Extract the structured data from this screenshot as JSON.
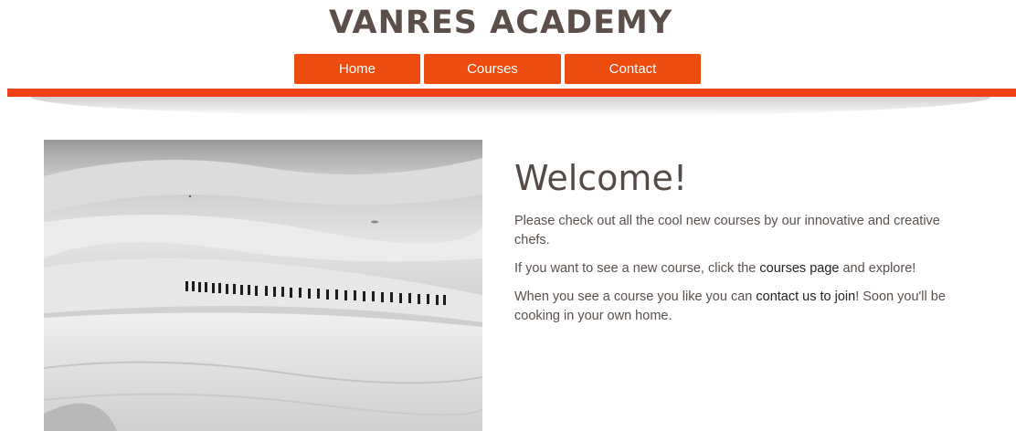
{
  "header": {
    "title": "VANRES ACADEMY"
  },
  "nav": {
    "home": "Home",
    "courses": "Courses",
    "contact": "Contact"
  },
  "colors": {
    "accent": "#ee4b0f",
    "bar": "#ee4117",
    "heading": "#554b46"
  },
  "hero": {
    "image_icon": "hikers-on-snow-image"
  },
  "main": {
    "heading": "Welcome!",
    "para1": "Please check out all the cool new courses by our innovative and creative chefs.",
    "para2_before": "If you want to see a new course, click the ",
    "para2_link": "courses page",
    "para2_after": " and explore!",
    "para3_before": "When you see a course you like you can ",
    "para3_link": "contact us to join",
    "para3_after": "! Soon you'll be cooking in your own home."
  }
}
